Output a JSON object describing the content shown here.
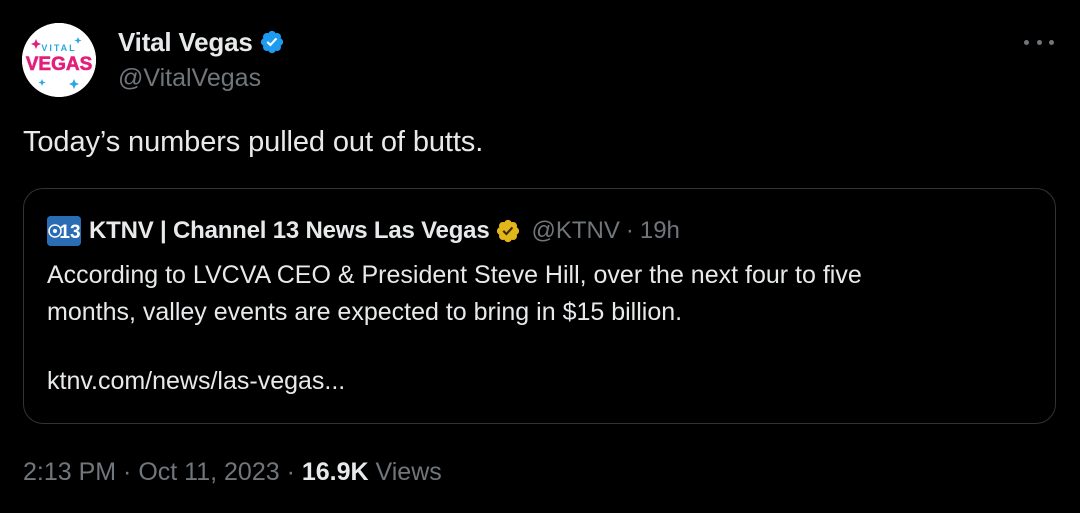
{
  "author": {
    "display_name": "Vital Vegas",
    "handle": "@VitalVegas",
    "avatar_text_top": "VITAL",
    "avatar_text_main": "VEGAS",
    "verified_color": "#1d9bf0"
  },
  "tweet": {
    "text": "Today’s numbers pulled out of butts."
  },
  "quote": {
    "logo_text": "13",
    "display_name": "KTNV | Channel 13 News Las Vegas",
    "badge_color": "#e2b719",
    "handle": "@KTNV",
    "separator": "·",
    "time_ago": "19h",
    "body_line1": "According to LVCVA CEO & President Steve Hill, over the next four to five",
    "body_line2": "months, valley events are expected to bring in $15 billion.",
    "link": "ktnv.com/news/las-vegas..."
  },
  "meta": {
    "time": "2:13 PM",
    "separator1": " · ",
    "date": "Oct 11, 2023",
    "separator2": " · ",
    "views_count": "16.9K",
    "views_label": " Views"
  },
  "icons": {
    "verified": "verified-badge-icon",
    "more": "more-horizontal-icon",
    "gold_badge": "gold-verified-badge-icon"
  }
}
